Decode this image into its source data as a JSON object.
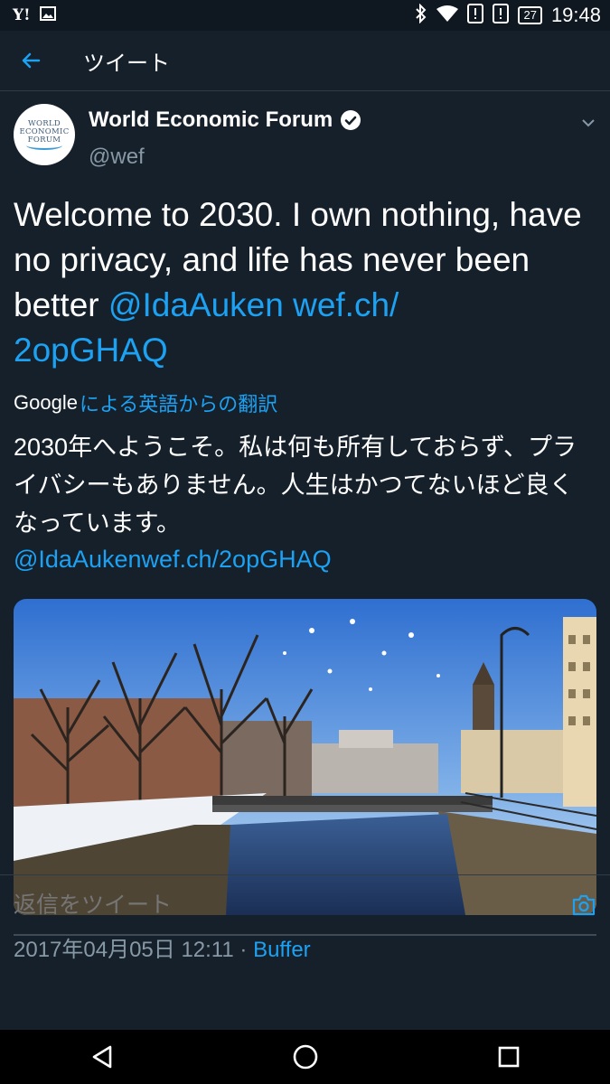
{
  "status_bar": {
    "left_icons": [
      "yahoo-icon",
      "image-icon"
    ],
    "yahoo_text": "Y!",
    "right_icons": [
      "bluetooth-icon",
      "wifi-icon",
      "alert-icon",
      "alert-icon",
      "battery-icon"
    ],
    "battery_level": "27",
    "time": "19:48"
  },
  "app_bar": {
    "back_icon": "arrow-left-icon",
    "title": "ツイート"
  },
  "tweet": {
    "author": {
      "avatar_lines": [
        "WORLD",
        "ECONOMIC",
        "FORUM"
      ],
      "display_name": "World Economic Forum",
      "verified": true,
      "handle": "@wef"
    },
    "text": {
      "body": "Welcome to 2030. I own nothing, have no privacy, and life has never been better ",
      "mention": "@IdaAuken",
      "link": "wef.ch/\n2opGHAQ"
    },
    "translation": {
      "provider": "Google",
      "label": "による英語からの翻訳",
      "text": "2030年へようこそ。私は何も所有しておらず、プライバシーもありません。人生はかつてないほど良くなっています。",
      "mention": "@IdaAuken",
      "link": "wef.ch/2opGHAQ"
    },
    "media": {
      "type": "photo",
      "description_icon": "photo-canal-city"
    },
    "meta": {
      "timestamp": "2017年04月05日 12:11",
      "separator": " · ",
      "source": "Buffer"
    }
  },
  "reply": {
    "placeholder": "返信をツイート",
    "camera_icon": "camera-icon"
  },
  "nav_bar": {
    "buttons": [
      "back-triangle-icon",
      "home-circle-icon",
      "recents-square-icon"
    ]
  },
  "colors": {
    "background": "#15202b",
    "accent": "#1da1f2",
    "secondary_text": "#8899a6"
  }
}
